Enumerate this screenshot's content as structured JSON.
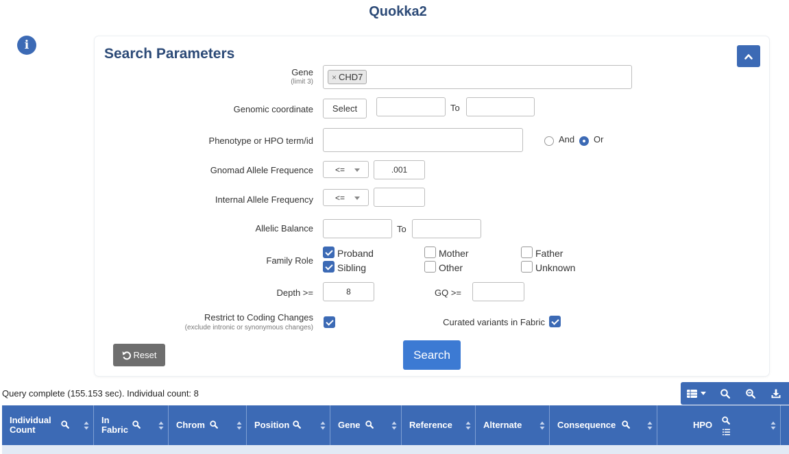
{
  "app": {
    "title": "Quokka2"
  },
  "panel": {
    "title": "Search Parameters",
    "gene": {
      "label": "Gene",
      "sublabel": "(limit 3)",
      "tag": "CHD7",
      "tag_remove": "×"
    },
    "genomic": {
      "label": "Genomic coordinate",
      "select_button": "Select",
      "from": "",
      "to_label": "To",
      "to": ""
    },
    "phenotype": {
      "label": "Phenotype or HPO term/id",
      "value": "",
      "and_label": "And",
      "or_label": "Or",
      "selected": "Or"
    },
    "gnomad": {
      "label": "Gnomad Allele Frequence",
      "operator": "<=",
      "value": ".001"
    },
    "internal": {
      "label": "Internal Allele Frequency",
      "operator": "<=",
      "value": ""
    },
    "allelic": {
      "label": "Allelic Balance",
      "from": "",
      "to_label": "To",
      "to": ""
    },
    "family_role": {
      "label": "Family Role",
      "options": [
        {
          "label": "Proband",
          "checked": true
        },
        {
          "label": "Mother",
          "checked": false
        },
        {
          "label": "Father",
          "checked": false
        },
        {
          "label": "Sibling",
          "checked": true
        },
        {
          "label": "Other",
          "checked": false
        },
        {
          "label": "Unknown",
          "checked": false
        }
      ]
    },
    "depth": {
      "label": "Depth >=",
      "value": "8"
    },
    "gq": {
      "label": "GQ >=",
      "value": ""
    },
    "coding": {
      "label": "Restrict to Coding Changes",
      "sublabel": "(exclude intronic or synonymous changes)",
      "checked": true
    },
    "curated": {
      "label": "Curated variants in Fabric",
      "checked": true
    },
    "reset_label": "Reset",
    "search_label": "Search"
  },
  "status": "Query complete (155.153 sec). Individual count: 8",
  "table": {
    "columns": [
      {
        "label": "Individual Count",
        "searchable": true
      },
      {
        "label": "In Fabric",
        "searchable": true
      },
      {
        "label": "Chrom",
        "searchable": true
      },
      {
        "label": "Position",
        "searchable": true
      },
      {
        "label": "Gene",
        "searchable": true
      },
      {
        "label": "Reference",
        "searchable": false
      },
      {
        "label": "Alternate",
        "searchable": false
      },
      {
        "label": "Consequence",
        "searchable": true
      },
      {
        "label": "HPO",
        "searchable": true
      }
    ]
  },
  "colors": {
    "accent": "#3c6ab5",
    "title": "#2c4a77",
    "search_button": "#3c7ad3",
    "reset_button": "#6e6e6e"
  },
  "icons": {
    "info": "info-icon",
    "collapse": "chevron-up-icon",
    "columns": "table-columns-icon",
    "search": "magnifier-icon",
    "zoom_out": "zoom-out-icon",
    "download": "download-icon",
    "sort": "sort-icon",
    "list": "list-icon",
    "reset": "undo-icon"
  }
}
